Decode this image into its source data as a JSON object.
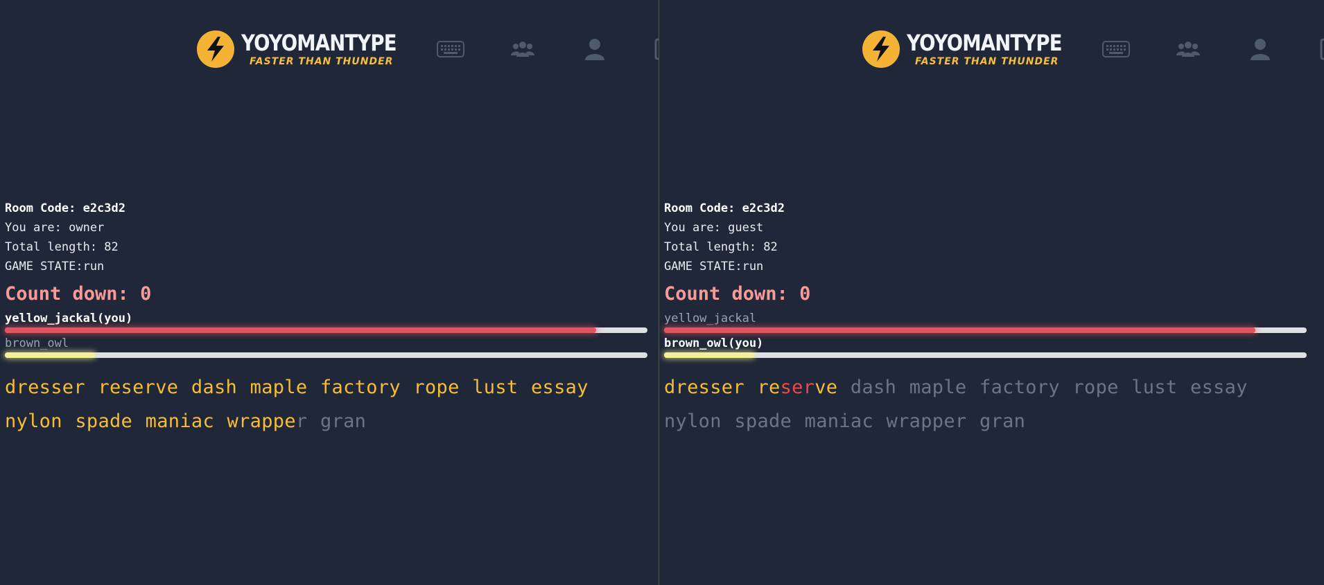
{
  "brand": {
    "title": "YOYOMANTYPE",
    "subtitle": "FASTER THAN THUNDER"
  },
  "nav": [
    {
      "icon": "keyboard-icon"
    },
    {
      "icon": "users-icon"
    },
    {
      "icon": "user-icon"
    },
    {
      "icon": "sign-in-icon"
    }
  ],
  "colors": {
    "background": "#1f2739",
    "accent": "#f7bd34",
    "error": "#ee4a4a",
    "pending": "#6b7588",
    "countdown": "#f79a9a"
  },
  "left": {
    "room_code": "Room Code: e2c3d2",
    "role": "You are: owner",
    "total_length": "Total length: 82",
    "game_state": "GAME STATE:run",
    "countdown": "Count down: 0",
    "players": [
      {
        "name": "yellow_jackal(you)",
        "progress": 0.92
      },
      {
        "name": "brown_owl",
        "progress": 0.14
      }
    ],
    "text": {
      "typed": "dresser reserve dash maple factory rope lust essay nylon spade maniac wrappe",
      "wrong": "",
      "pending": "r gran"
    }
  },
  "right": {
    "room_code": "Room Code: e2c3d2",
    "role": "You are: guest",
    "total_length": "Total length: 82",
    "game_state": "GAME STATE:run",
    "countdown": "Count down: 0",
    "players": [
      {
        "name": "yellow_jackal",
        "progress": 0.92
      },
      {
        "name": "brown_owl(you)",
        "progress": 0.14
      }
    ],
    "text": {
      "typed": "dresser re",
      "wrong": "ser",
      "typed2": "ve",
      "pending": " dash maple factory rope lust essay nylon spade maniac wrapper gran"
    }
  }
}
